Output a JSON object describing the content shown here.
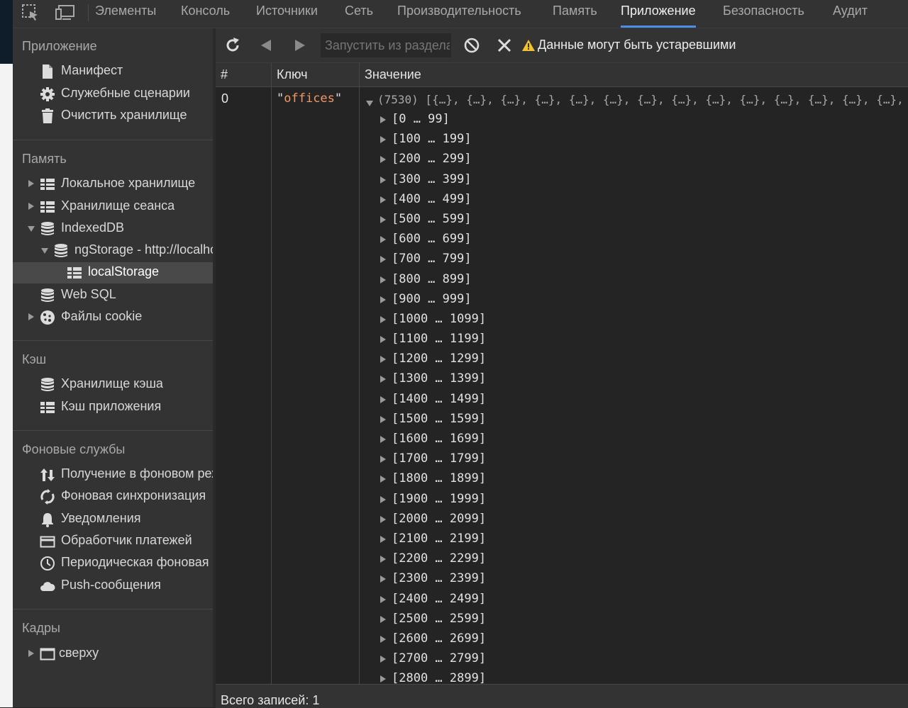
{
  "tabs": [
    {
      "label": "Элементы"
    },
    {
      "label": "Консоль"
    },
    {
      "label": "Источники"
    },
    {
      "label": "Сеть"
    },
    {
      "label": "Производительность"
    },
    {
      "label": "Память"
    },
    {
      "label": "Приложение",
      "active": true
    },
    {
      "label": "Безопасность"
    },
    {
      "label": "Аудит"
    }
  ],
  "topbar_icons": [
    "inspect-element-icon",
    "device-toolbar-icon"
  ],
  "sidebar": {
    "app": {
      "title": "Приложение",
      "items": [
        {
          "label": "Манифест",
          "icon": "document-icon"
        },
        {
          "label": "Служебные сценарии",
          "icon": "gear-icon"
        },
        {
          "label": "Очистить хранилище",
          "icon": "trash-icon"
        }
      ]
    },
    "memory": {
      "title": "Память",
      "items": [
        {
          "label": "Локальное хранилище",
          "icon": "table-grid-icon",
          "arrow": "right"
        },
        {
          "label": "Хранилище сеанса",
          "icon": "table-grid-icon",
          "arrow": "right"
        },
        {
          "label": "IndexedDB",
          "icon": "database-icon",
          "arrow": "down"
        },
        {
          "label": "ngStorage - http://localhost",
          "icon": "database-icon",
          "arrow": "down"
        },
        {
          "label": "localStorage",
          "icon": "table-grid-icon",
          "selected": true
        },
        {
          "label": "Web SQL",
          "icon": "database-icon"
        },
        {
          "label": "Файлы cookie",
          "icon": "cookie-icon",
          "arrow": "right"
        }
      ]
    },
    "cache": {
      "title": "Кэш",
      "items": [
        {
          "label": "Хранилище кэша",
          "icon": "database-icon"
        },
        {
          "label": "Кэш приложения",
          "icon": "table-grid-icon"
        }
      ]
    },
    "background": {
      "title": "Фоновые службы",
      "items": [
        {
          "label": "Получение в фоновом режиме",
          "icon": "up-down-arrows-icon"
        },
        {
          "label": "Фоновая синхронизация",
          "icon": "sync-icon"
        },
        {
          "label": "Уведомления",
          "icon": "bell-icon"
        },
        {
          "label": "Обработчик платежей",
          "icon": "credit-card-icon"
        },
        {
          "label": "Периодическая фоновая синхронизация",
          "icon": "clock-icon"
        },
        {
          "label": "Push-сообщения",
          "icon": "cloud-icon"
        }
      ]
    },
    "frames": {
      "title": "Кадры",
      "items": [
        {
          "label": "сверху",
          "icon": "window-icon",
          "arrow": "right"
        }
      ]
    }
  },
  "toolbar": {
    "filter_placeholder": "Запустить из раздела",
    "warning": "Данные могут быть устаревшими"
  },
  "table": {
    "headers": {
      "num": "#",
      "key": "Ключ",
      "value": "Значение"
    },
    "row": {
      "num": "0",
      "key": "offices",
      "value_summary": "(7530) [{…}, {…}, {…}, {…}, {…}, {…}, {…}, {…}, {…}, {…}, {…}, {…}, {…}, {…},",
      "ranges": [
        "[0 … 99]",
        "[100 … 199]",
        "[200 … 299]",
        "[300 … 399]",
        "[400 … 499]",
        "[500 … 599]",
        "[600 … 699]",
        "[700 … 799]",
        "[800 … 899]",
        "[900 … 999]",
        "[1000 … 1099]",
        "[1100 … 1199]",
        "[1200 … 1299]",
        "[1300 … 1399]",
        "[1400 … 1499]",
        "[1500 … 1599]",
        "[1600 … 1699]",
        "[1700 … 1799]",
        "[1800 … 1899]",
        "[1900 … 1999]",
        "[2000 … 2099]",
        "[2100 … 2199]",
        "[2200 … 2299]",
        "[2300 … 2399]",
        "[2400 … 2499]",
        "[2500 … 2599]",
        "[2600 … 2699]",
        "[2700 … 2799]",
        "[2800 … 2899]"
      ]
    }
  },
  "footer": {
    "text": "Всего записей: 1"
  },
  "colors": {
    "accent": "#4d8ee8",
    "string": "#f29766",
    "warning": "#f2c12e"
  }
}
